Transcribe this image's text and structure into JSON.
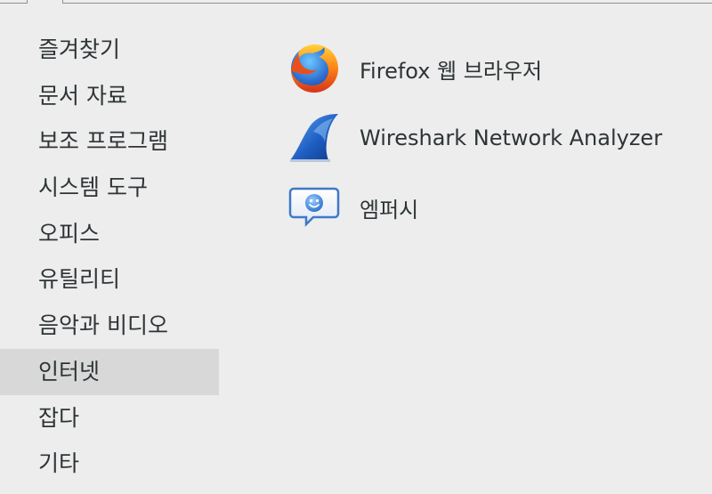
{
  "categories": [
    {
      "label": "즐겨찾기",
      "selected": false
    },
    {
      "label": "문서 자료",
      "selected": false
    },
    {
      "label": "보조 프로그램",
      "selected": false
    },
    {
      "label": "시스템 도구",
      "selected": false
    },
    {
      "label": "오피스",
      "selected": false
    },
    {
      "label": "유틸리티",
      "selected": false
    },
    {
      "label": "음악과 비디오",
      "selected": false
    },
    {
      "label": "인터넷",
      "selected": true
    },
    {
      "label": "잡다",
      "selected": false
    },
    {
      "label": "기타",
      "selected": false
    }
  ],
  "apps": [
    {
      "label": "Firefox 웹 브라우저",
      "icon": "firefox-icon"
    },
    {
      "label": "Wireshark Network Analyzer",
      "icon": "wireshark-icon"
    },
    {
      "label": "엠퍼시",
      "icon": "empathy-icon"
    }
  ],
  "colors": {
    "background": "#ededed",
    "selected_category": "#d8d8d8",
    "text": "#2e3436"
  }
}
